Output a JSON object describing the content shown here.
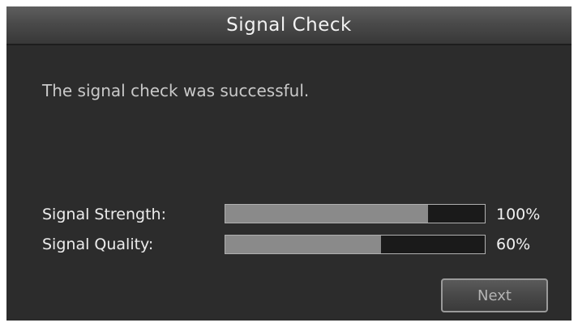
{
  "title": "Signal Check",
  "message": "The signal check was successful.",
  "meters": {
    "strength": {
      "label": "Signal Strength:",
      "value_text": "100%",
      "fill_fraction": 0.78
    },
    "quality": {
      "label": "Signal Quality:",
      "value_text": "60%",
      "fill_fraction": 0.6
    }
  },
  "next_button": {
    "label": "Next"
  },
  "colors": {
    "background": "#2c2c2c",
    "title_bar": "#4a4a4a",
    "meter_fill": "#8a8a8a",
    "meter_track": "#1a1a1a"
  }
}
